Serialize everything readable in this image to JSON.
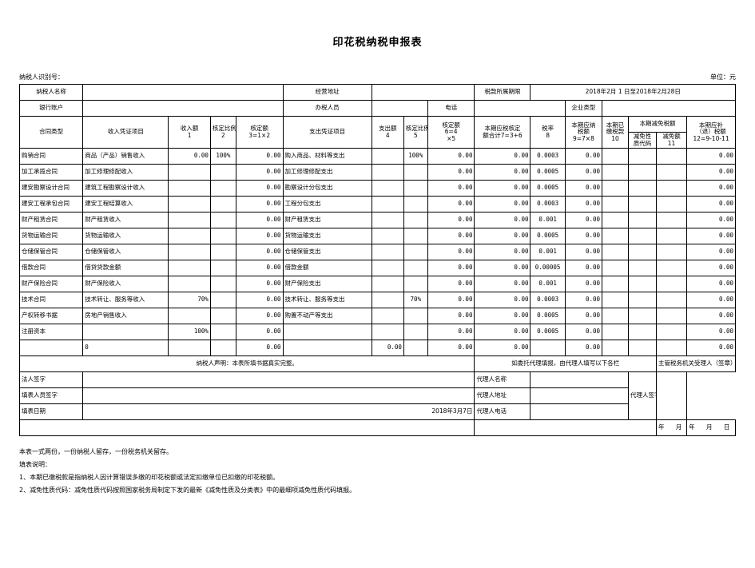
{
  "document": {
    "title": "印花税纳税申报表",
    "taxpayer_id_label": "纳税人识别号：",
    "unit_label": "单位：元"
  },
  "header_info": {
    "taxpayer_name_label": "纳税人名称",
    "taxpayer_name_value": "",
    "business_address_label": "经营地址",
    "business_address_value": "",
    "tax_period_label": "税款所属期限",
    "tax_period_value": "2018年2月  1  日至2018年2月28日",
    "bank_account_label": "银行账户",
    "bank_account_value": "",
    "tax_officer_label": "办税人员",
    "tax_officer_value": "",
    "phone_label": "电话",
    "phone_value": "",
    "enterprise_type_label": "企业类型",
    "enterprise_type_value": ""
  },
  "columns": {
    "contract_type": "合同类型",
    "income_voucher_item": "收入凭证项目",
    "income_amount": "收入额",
    "income_amount_no": "1",
    "income_ratio": "核定比例",
    "income_ratio_no": "2",
    "income_assessed": "核定额",
    "income_assessed_formula": "3=1×2",
    "expense_voucher_item": "支出凭证项目",
    "expense_amount": "支出额",
    "expense_amount_no": "4",
    "expense_ratio": "核定比例",
    "expense_ratio_no": "5",
    "expense_assessed": "核定额",
    "expense_assessed_formula": "6=4",
    "expense_assessed_formula2": "×5",
    "taxable_total": "本期应税核定",
    "taxable_total2": "额合计7=3+6",
    "tax_rate": "税率",
    "tax_rate_no": "8",
    "tax_payable": "本期应纳",
    "tax_payable2": "税额",
    "tax_payable_formula": "9=7×8",
    "tax_paid": "本期已",
    "tax_paid2": "缴税款",
    "tax_paid_no": "10",
    "reduction_group": "本期减免税额",
    "reduction_code": "减免性",
    "reduction_code2": "质代码",
    "reduction_amount": "减免额",
    "reduction_amount_no": "11",
    "tax_due": "本期应补",
    "tax_due2": "（退）税额",
    "tax_due_formula": "12=9-10-11"
  },
  "rows": [
    {
      "contract_type": "购销合同",
      "income_item": "商品（产品）销售收入",
      "income_amount": "0.00",
      "income_ratio": "100%",
      "income_assessed": "0.00",
      "expense_item": "购入商品、材料等支出",
      "expense_amount": "",
      "expense_ratio": "100%",
      "expense_assessed": "0.00",
      "taxable_total": "0.00",
      "tax_rate": "0.0003",
      "tax_payable": "0.00",
      "tax_paid": "",
      "reduction_code": "",
      "reduction_amount": "",
      "tax_due": "0.00"
    },
    {
      "contract_type": "加工承揽合同",
      "income_item": "加工修理修配收入",
      "income_amount": "",
      "income_ratio": "",
      "income_assessed": "0.00",
      "expense_item": "加工修理修配支出",
      "expense_amount": "",
      "expense_ratio": "",
      "expense_assessed": "0.00",
      "taxable_total": "0.00",
      "tax_rate": "0.0005",
      "tax_payable": "0.00",
      "tax_paid": "",
      "reduction_code": "",
      "reduction_amount": "",
      "tax_due": "0.00"
    },
    {
      "contract_type": "建安勘察设计合同",
      "income_item": "建筑工程勘察设计收入",
      "income_amount": "",
      "income_ratio": "",
      "income_assessed": "0.00",
      "expense_item": "勘察设计分包支出",
      "expense_amount": "",
      "expense_ratio": "",
      "expense_assessed": "0.00",
      "taxable_total": "0.00",
      "tax_rate": "0.0005",
      "tax_payable": "0.00",
      "tax_paid": "",
      "reduction_code": "",
      "reduction_amount": "",
      "tax_due": "0.00"
    },
    {
      "contract_type": "建安工程承包合同",
      "income_item": "建安工程结算收入",
      "income_amount": "",
      "income_ratio": "",
      "income_assessed": "0.00",
      "expense_item": "工程分包支出",
      "expense_amount": "",
      "expense_ratio": "",
      "expense_assessed": "0.00",
      "taxable_total": "0.00",
      "tax_rate": "0.0003",
      "tax_payable": "0.00",
      "tax_paid": "",
      "reduction_code": "",
      "reduction_amount": "",
      "tax_due": "0.00"
    },
    {
      "contract_type": "财产租赁合同",
      "income_item": "财产租赁收入",
      "income_amount": "",
      "income_ratio": "",
      "income_assessed": "0.00",
      "expense_item": "财产租赁支出",
      "expense_amount": "",
      "expense_ratio": "",
      "expense_assessed": "0.00",
      "taxable_total": "0.00",
      "tax_rate": "0.001",
      "tax_payable": "0.00",
      "tax_paid": "",
      "reduction_code": "",
      "reduction_amount": "",
      "tax_due": "0.00"
    },
    {
      "contract_type": "货物运输合同",
      "income_item": "货物运输收入",
      "income_amount": "",
      "income_ratio": "",
      "income_assessed": "0.00",
      "expense_item": "货物运输支出",
      "expense_amount": "",
      "expense_ratio": "",
      "expense_assessed": "0.00",
      "taxable_total": "0.00",
      "tax_rate": "0.0005",
      "tax_payable": "0.00",
      "tax_paid": "",
      "reduction_code": "",
      "reduction_amount": "",
      "tax_due": "0.00"
    },
    {
      "contract_type": "仓储保管合同",
      "income_item": "仓储保管收入",
      "income_amount": "",
      "income_ratio": "",
      "income_assessed": "0.00",
      "expense_item": "仓储保管支出",
      "expense_amount": "",
      "expense_ratio": "",
      "expense_assessed": "0.00",
      "taxable_total": "0.00",
      "tax_rate": "0.001",
      "tax_payable": "0.00",
      "tax_paid": "",
      "reduction_code": "",
      "reduction_amount": "",
      "tax_due": "0.00"
    },
    {
      "contract_type": "借款合同",
      "income_item": "借贷贷款金额",
      "income_amount": "",
      "income_ratio": "",
      "income_assessed": "0.00",
      "expense_item": "借款金额",
      "expense_amount": "",
      "expense_ratio": "",
      "expense_assessed": "0.00",
      "taxable_total": "0.00",
      "tax_rate": "0.00005",
      "tax_payable": "0.00",
      "tax_paid": "",
      "reduction_code": "",
      "reduction_amount": "",
      "tax_due": "0.00"
    },
    {
      "contract_type": "财产保险合同",
      "income_item": "财产保险收入",
      "income_amount": "",
      "income_ratio": "",
      "income_assessed": "0.00",
      "expense_item": "财产保险支出",
      "expense_amount": "",
      "expense_ratio": "",
      "expense_assessed": "0.00",
      "taxable_total": "0.00",
      "tax_rate": "0.001",
      "tax_payable": "0.00",
      "tax_paid": "",
      "reduction_code": "",
      "reduction_amount": "",
      "tax_due": "0.00"
    },
    {
      "contract_type": "技术合同",
      "income_item": "技术转让、服务等收入",
      "income_amount": "70%",
      "income_ratio": "",
      "income_assessed": "0.00",
      "expense_item": "技术转让、服务等支出",
      "expense_amount": "",
      "expense_ratio": "70%",
      "expense_assessed": "0.00",
      "taxable_total": "0.00",
      "tax_rate": "0.0003",
      "tax_payable": "0.00",
      "tax_paid": "",
      "reduction_code": "",
      "reduction_amount": "",
      "tax_due": "0.00"
    },
    {
      "contract_type": "产权转移书据",
      "income_item": "房地产销售收入",
      "income_amount": "",
      "income_ratio": "",
      "income_assessed": "0.00",
      "expense_item": "购置不动产等支出",
      "expense_amount": "",
      "expense_ratio": "",
      "expense_assessed": "0.00",
      "taxable_total": "0.00",
      "tax_rate": "0.0005",
      "tax_payable": "0.00",
      "tax_paid": "",
      "reduction_code": "",
      "reduction_amount": "",
      "tax_due": "0.00"
    },
    {
      "contract_type": "注册资本",
      "income_item": "",
      "income_amount": "100%",
      "income_ratio": "",
      "income_assessed": "0.00",
      "expense_item": "",
      "expense_amount": "",
      "expense_ratio": "",
      "expense_assessed": "0.00",
      "taxable_total": "0.00",
      "tax_rate": "0.0005",
      "tax_payable": "0.00",
      "tax_paid": "",
      "reduction_code": "",
      "reduction_amount": "",
      "tax_due": "0.00"
    },
    {
      "contract_type": "",
      "income_item": "0",
      "income_amount": "",
      "income_ratio": "",
      "income_assessed": "0.00",
      "expense_item": "",
      "expense_amount": "0.00",
      "expense_ratio": "",
      "expense_assessed": "0.00",
      "taxable_total": "0.00",
      "tax_rate": "",
      "tax_payable": "0.00",
      "tax_paid": "",
      "reduction_code": "",
      "reduction_amount": "",
      "tax_due": "0.00"
    }
  ],
  "footer": {
    "declaration": "纳税人声明：本表所填书据真实完整。",
    "agent_notice": "如委托代理填报，由代理人填写以下各栏",
    "authority_receiver": "主管税务机关受理人（签章）",
    "legal_person_sign_label": "法人签字",
    "legal_person_sign_value": "",
    "preparer_sign_label": "填表人员签字",
    "preparer_sign_value": "",
    "fill_date_label": "填表日期",
    "fill_date_value": "2018年3月7日",
    "agent_name_label": "代理人名称",
    "agent_name_value": "",
    "agent_address_label": "代理人地址",
    "agent_address_value": "",
    "agent_phone_label": "代理人电话",
    "agent_phone_value": "",
    "agent_sign_label": "代理人签字（盖章）：",
    "agent_date": "年  月  日",
    "authority_date": "年  月  日"
  },
  "notes": {
    "copies": "本表一式两份，一份纳税人留存，一份税务机关留存。",
    "instructions_title": "填表说明：",
    "note1": "1、本期已缴税款是指纳税人因计算错误多缴的印花税额或法定扣缴单位已扣缴的印花税额。",
    "note2": "2、减免性质代码：减免性质代码按照国家税务局制定下发的最新《减免性质及分类表》中的最细项减免性质代码填报。"
  }
}
